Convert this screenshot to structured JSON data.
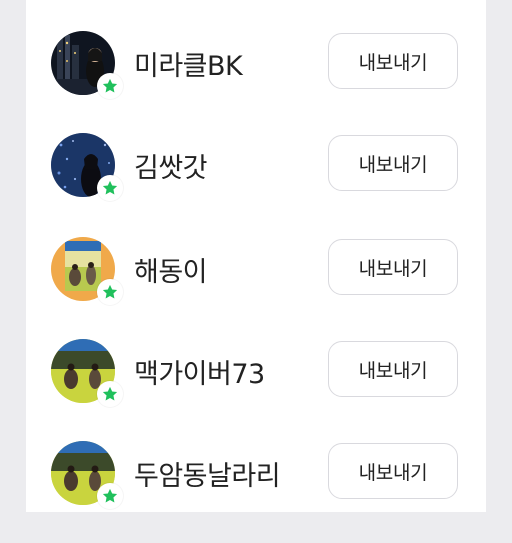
{
  "members": [
    {
      "name": "미라클BK",
      "action_label": "내보내기",
      "avatar_icon": "night-city-photo-avatar"
    },
    {
      "name": "김쌋갓",
      "action_label": "내보내기",
      "avatar_icon": "blue-star-photo-avatar"
    },
    {
      "name": "해동이",
      "action_label": "내보내기",
      "avatar_icon": "orange-stadium-photo-avatar"
    },
    {
      "name": "맥가이버73",
      "action_label": "내보내기",
      "avatar_icon": "stadium-photo-avatar"
    },
    {
      "name": "두암동날라리",
      "action_label": "내보내기",
      "avatar_icon": "stadium-photo-avatar"
    }
  ],
  "badge_icon": "star-badge-icon",
  "colors": {
    "badge_star": "#20c05c",
    "background": "#ececef",
    "sheet": "#ffffff",
    "button_border": "#d9d9de",
    "text": "#222222"
  }
}
